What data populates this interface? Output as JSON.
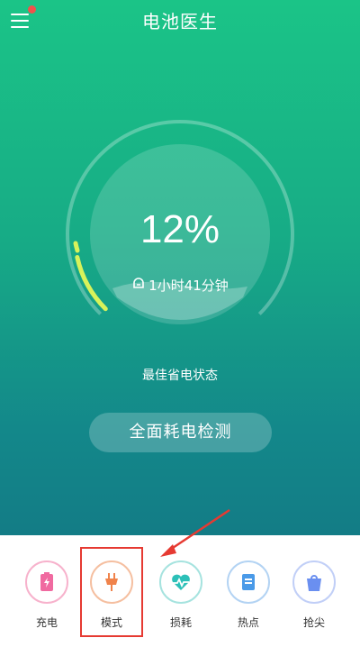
{
  "header": {
    "title": "电池医生",
    "menu_icon": "menu-icon"
  },
  "battery": {
    "percent_text": "12%",
    "level": 0.12,
    "remaining_text": "1小时41分钟",
    "status_text": "最佳省电状态"
  },
  "actions": {
    "detect_label": "全面耗电检测"
  },
  "nav": {
    "items": [
      {
        "label": "充电",
        "icon": "charging-battery-icon",
        "color": "#f06aa0"
      },
      {
        "label": "模式",
        "icon": "plug-icon",
        "color": "#f0834b"
      },
      {
        "label": "损耗",
        "icon": "heart-pulse-icon",
        "color": "#2cc0b8"
      },
      {
        "label": "热点",
        "icon": "document-icon",
        "color": "#4a9ae8"
      },
      {
        "label": "抢尖",
        "icon": "shopping-bag-icon",
        "color": "#6a8ff0"
      }
    ]
  },
  "colors": {
    "gauge_fill": "#d8f25a",
    "highlight": "#e63a32",
    "menu_badge": "#f0524b"
  }
}
